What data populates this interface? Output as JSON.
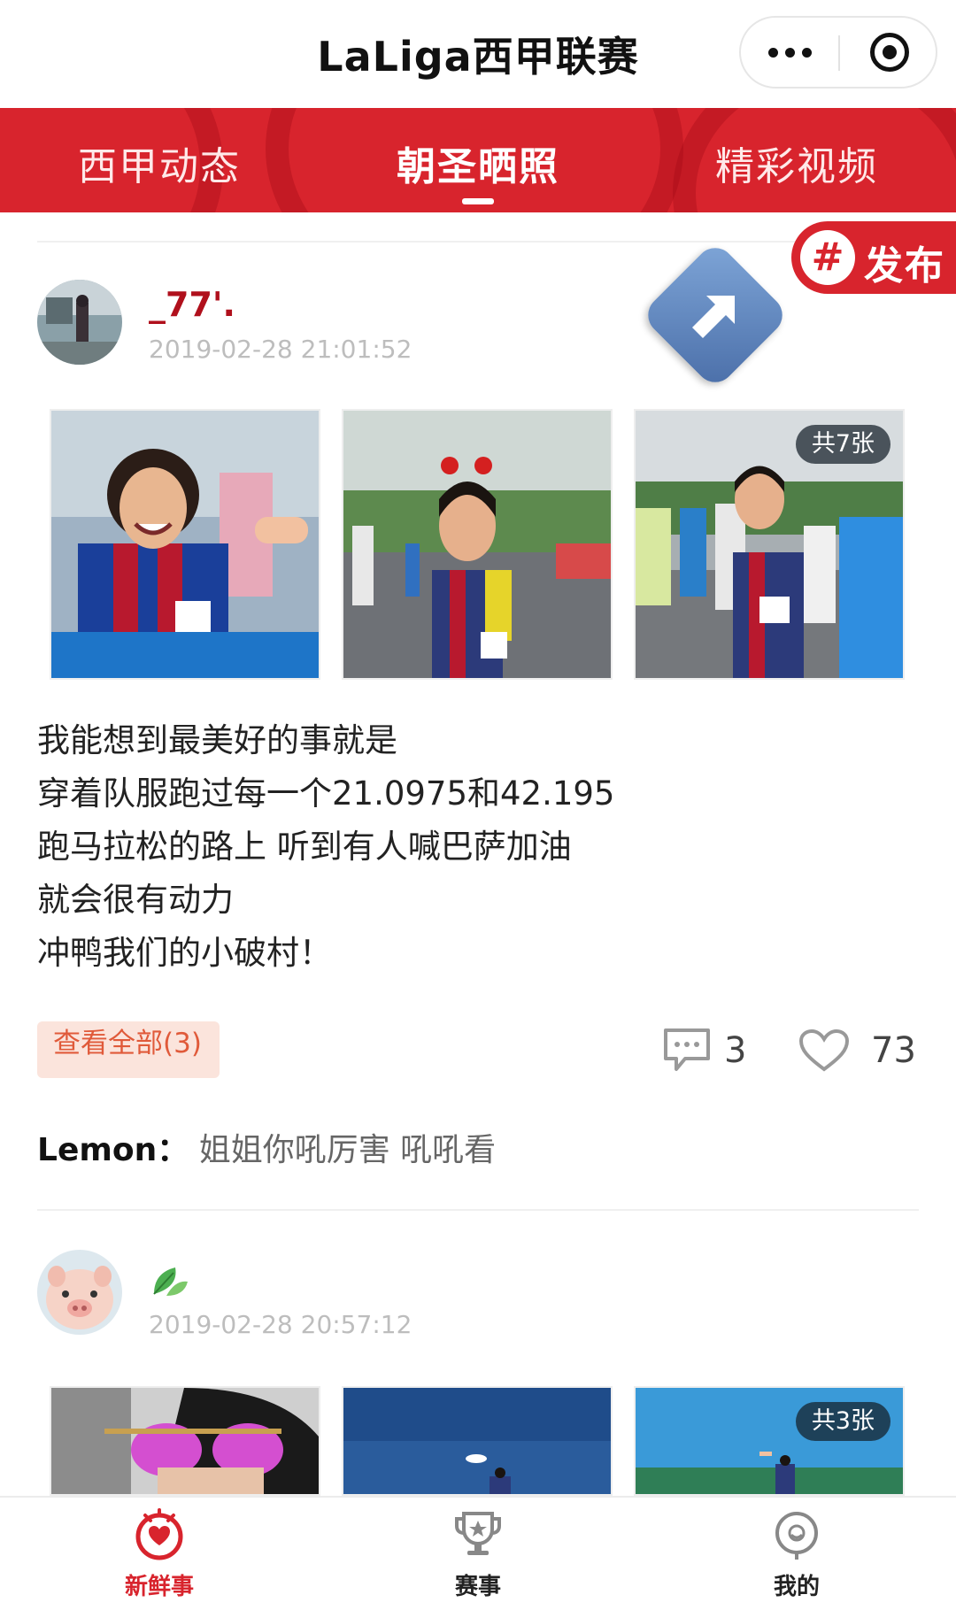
{
  "header": {
    "title": "LaLiga西甲联赛"
  },
  "tabs": [
    {
      "label": "西甲动态"
    },
    {
      "label": "朝圣晒照"
    },
    {
      "label": "精彩视频"
    }
  ],
  "publish": {
    "symbol": "#",
    "label": "发布"
  },
  "posts": [
    {
      "username": "_77'.",
      "timestamp": "2019-02-28 21:01:52",
      "photo_count_badge": "共7张",
      "caption": [
        "我能想到最美好的事就是",
        "穿着队服跑过每一个21.0975和42.195",
        "跑马拉松的路上 听到有人喊巴萨加油",
        "就会很有动力",
        "冲鸭我们的小破村！"
      ],
      "view_all": "查看全部(3)",
      "comments_count": "3",
      "likes_count": "73",
      "top_comment": {
        "author": "Lemon：",
        "text": "姐姐你吼厉害 吼吼看"
      }
    },
    {
      "username_icon": "leaf-icon",
      "timestamp": "2019-02-28 20:57:12",
      "photo_count_badge": "共3张"
    }
  ],
  "bottom_nav": [
    {
      "label": "新鲜事",
      "icon": "fresh-news-icon",
      "active": true
    },
    {
      "label": "赛事",
      "icon": "trophy-icon",
      "active": false
    },
    {
      "label": "我的",
      "icon": "profile-icon",
      "active": false
    }
  ],
  "colors": {
    "brand_red": "#d8242d",
    "username_red": "#b0101c",
    "view_all_bg": "#fbe4dc"
  }
}
